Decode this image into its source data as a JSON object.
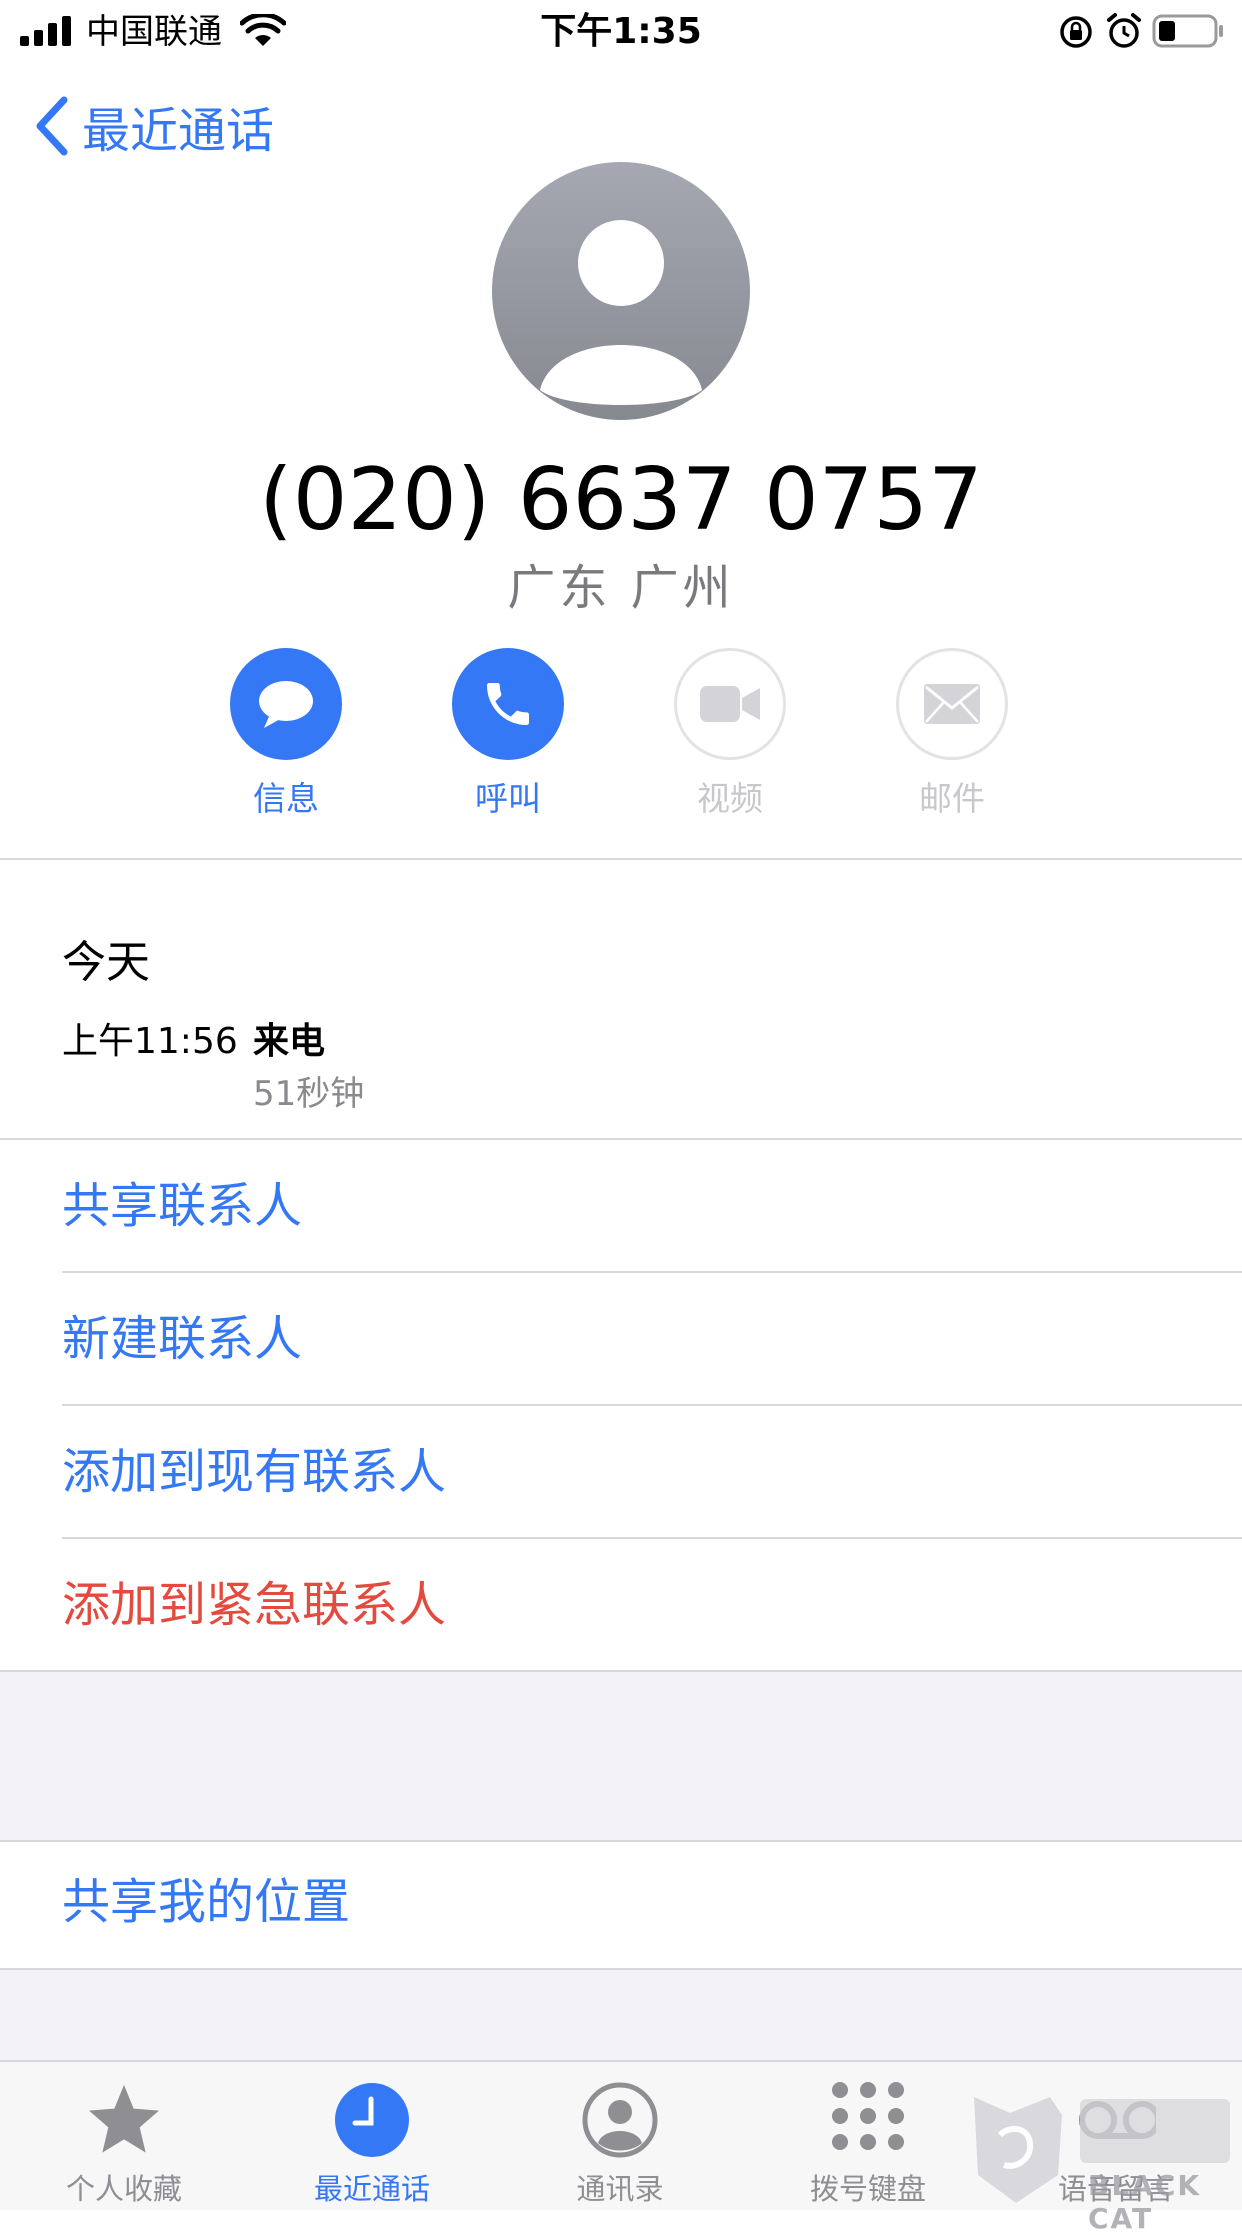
{
  "status_bar": {
    "carrier": "中国联通",
    "time": "下午1:35"
  },
  "nav": {
    "back_label": "最近通话"
  },
  "contact": {
    "phone": "(020) 6637 0757",
    "location": "广东 广州"
  },
  "actions": [
    {
      "label": "信息",
      "icon": "message-icon",
      "enabled": true
    },
    {
      "label": "呼叫",
      "icon": "phone-icon",
      "enabled": true
    },
    {
      "label": "视频",
      "icon": "video-icon",
      "enabled": false
    },
    {
      "label": "邮件",
      "icon": "mail-icon",
      "enabled": false
    }
  ],
  "recent": {
    "day": "今天",
    "time": "上午11:56",
    "type": "来电",
    "duration": "51秒钟"
  },
  "options": [
    {
      "label": "共享联系人",
      "color": "#3478f6"
    },
    {
      "label": "新建联系人",
      "color": "#3478f6"
    },
    {
      "label": "添加到现有联系人",
      "color": "#3478f6"
    },
    {
      "label": "添加到紧急联系人",
      "color": "#e44a3d"
    }
  ],
  "share_location": "共享我的位置",
  "tabs": [
    {
      "label": "个人收藏",
      "icon": "star-icon",
      "active": false
    },
    {
      "label": "最近通话",
      "icon": "clock-icon",
      "active": true
    },
    {
      "label": "通讯录",
      "icon": "contacts-icon",
      "active": false
    },
    {
      "label": "拨号键盘",
      "icon": "keypad-icon",
      "active": false
    },
    {
      "label": "语音留言",
      "icon": "voicemail-icon",
      "active": false
    }
  ],
  "watermark": {
    "text": "BLACK CAT"
  },
  "colors": {
    "accent": "#3478f6",
    "danger": "#e44a3d"
  }
}
